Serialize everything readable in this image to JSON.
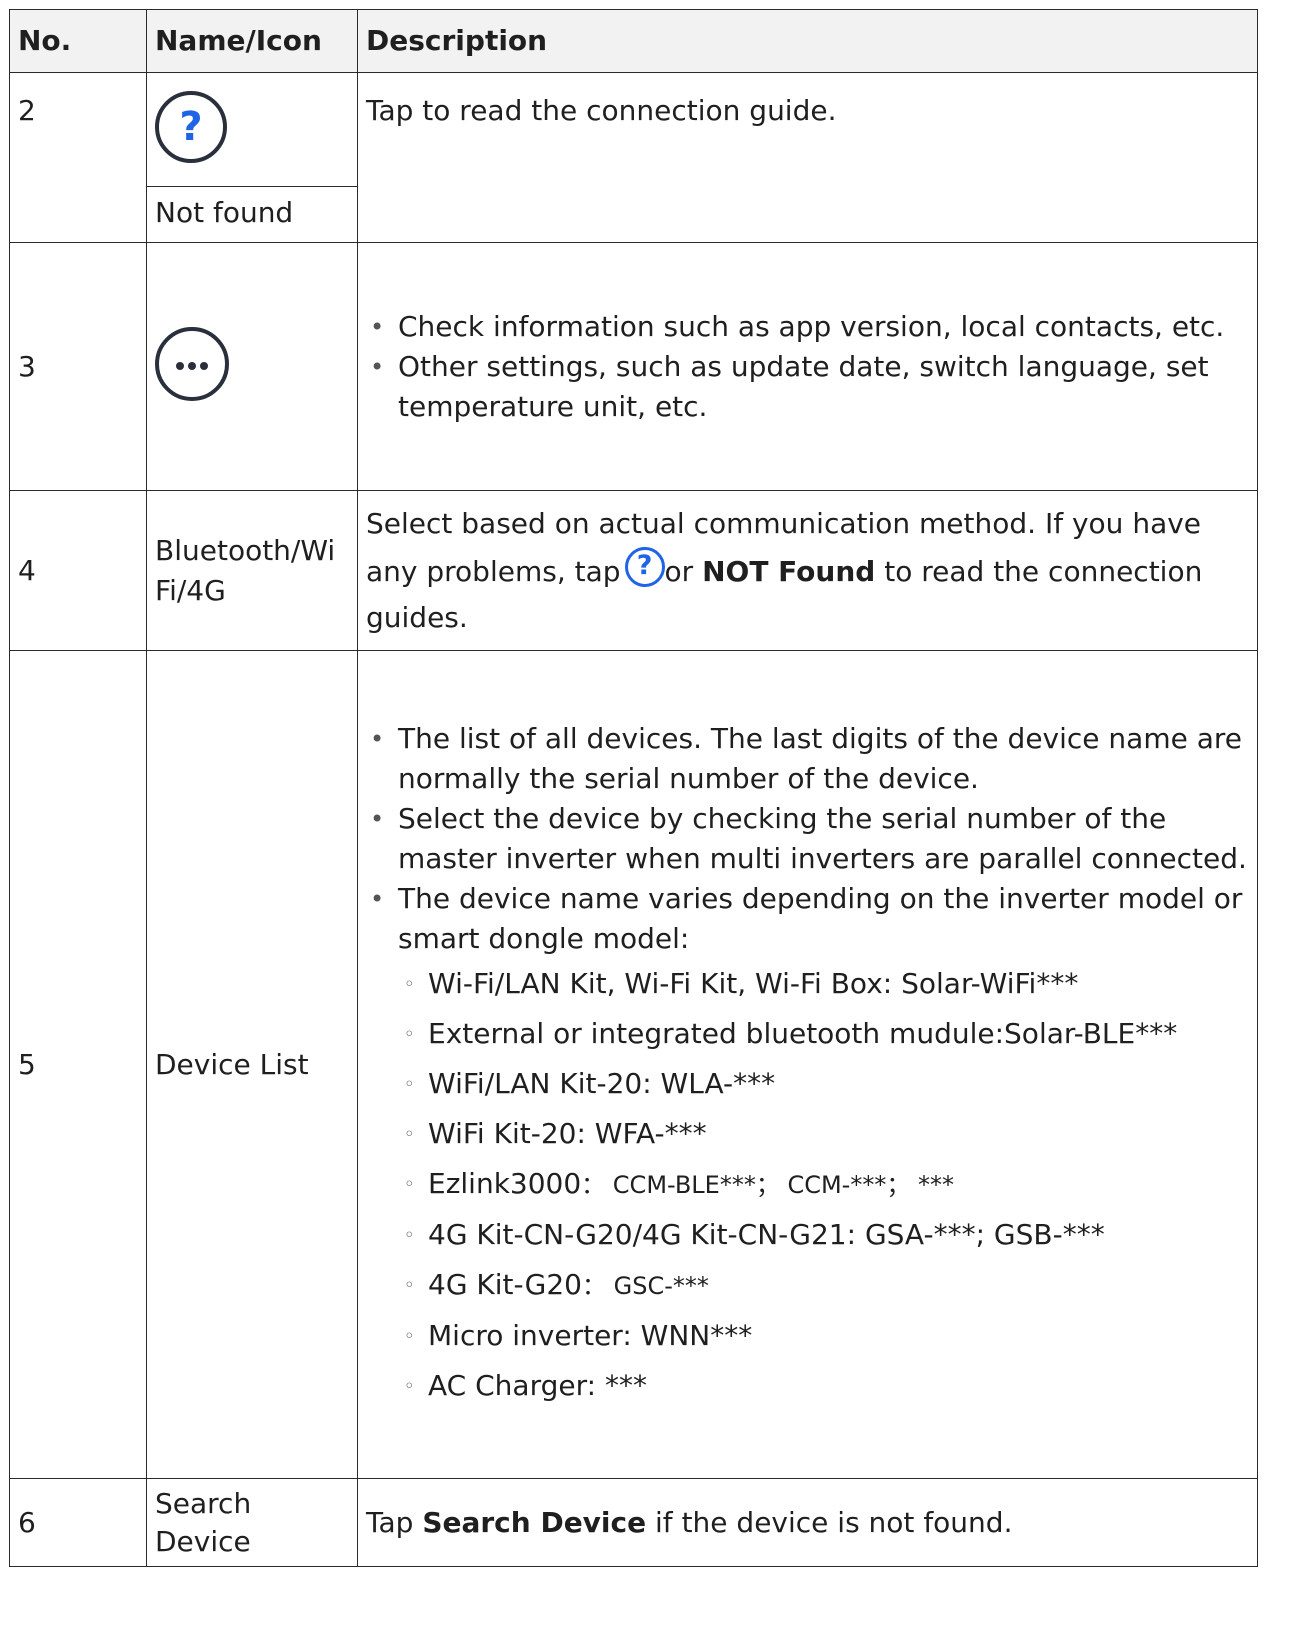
{
  "header": {
    "no": "No.",
    "name": "Name/Icon",
    "description": "Description"
  },
  "rows": [
    {
      "no": "2",
      "icon": "help-icon",
      "name": "Not found",
      "description": "Tap to read the connection guide."
    },
    {
      "no": "3",
      "icon": "more-icon",
      "bullets": [
        "Check information such as app version, local contacts, etc.",
        "Other settings, such as update date, switch language, set temperature unit, etc."
      ]
    },
    {
      "no": "4",
      "name": "Bluetooth/Wi Fi/4G",
      "desc_a": "Select based on actual communication method. If you have any problems, tap",
      "desc_b": "or",
      "desc_bold": "NOT Found",
      "desc_c": "to read the connection guides."
    },
    {
      "no": "5",
      "name": "Device List",
      "bullets": [
        "The list of all devices. The last digits of the device name are normally the serial number of the device.",
        "Select the device by checking the serial number of the master inverter when multi inverters are parallel connected.",
        "The device name varies depending on the inverter model or smart dongle model:"
      ],
      "sub": [
        "Wi-Fi/LAN Kit, Wi-Fi Kit, Wi-Fi Box: Solar-WiFi***",
        "External or integrated bluetooth mudule:Solar-BLE***",
        "WiFi/LAN Kit-20: WLA-***",
        "WiFi Kit-20: WFA-***",
        "Ezlink3000",
        "4G Kit-CN-G20/4G Kit-CN-G21: GSA-***; GSB-***",
        "4G Kit-G20",
        "Micro inverter: WNN***",
        "AC Charger: ***"
      ],
      "sub_small": {
        "ezlink": "：  CCM-BLE***；  CCM-***；  ***",
        "g20": "：  GSC-***"
      }
    },
    {
      "no": "6",
      "name": "Search Device",
      "desc_a": "Tap",
      "desc_bold": "Search Device",
      "desc_c": "if the device is not found."
    }
  ]
}
